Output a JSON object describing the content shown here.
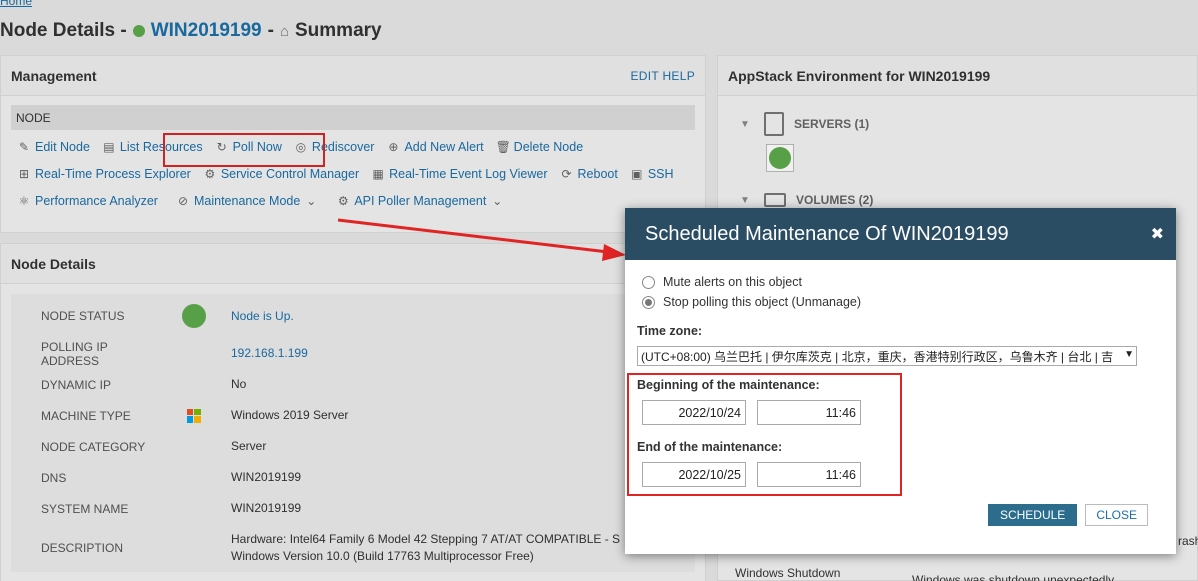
{
  "breadcrumb": "Home",
  "header": {
    "prefix": "Node Details -",
    "node_name": "WIN2019199",
    "separator": "-",
    "section": "Summary"
  },
  "management": {
    "title": "Management",
    "edit_help": "EDIT HELP",
    "node_bar": "NODE",
    "row1": [
      "Edit Node",
      "List Resources",
      "Poll Now",
      "Rediscover",
      "Add New Alert",
      "Delete Node"
    ],
    "row2": [
      "Real-Time Process Explorer",
      "Service Control Manager",
      "Real-Time Event Log Viewer",
      "Reboot",
      "SSH"
    ],
    "row3": [
      "Performance Analyzer",
      "Maintenance Mode",
      "API Poller Management"
    ]
  },
  "node_details": {
    "title": "Node Details",
    "rows": [
      {
        "key": "NODE STATUS",
        "value": "Node is Up."
      },
      {
        "key": "POLLING IP ADDRESS",
        "value": "192.168.1.199"
      },
      {
        "key": "DYNAMIC IP",
        "value": "No"
      },
      {
        "key": "MACHINE TYPE",
        "value": "Windows 2019 Server"
      },
      {
        "key": "NODE CATEGORY",
        "value": "Server"
      },
      {
        "key": "DNS",
        "value": "WIN2019199"
      },
      {
        "key": "SYSTEM NAME",
        "value": "WIN2019199"
      },
      {
        "key": "DESCRIPTION",
        "value": "Hardware: Intel64 Family 6 Model 42 Stepping 7 AT/AT COMPATIBLE - S",
        "value2": "Windows Version 10.0 (Build 17763 Multiprocessor Free)"
      }
    ]
  },
  "appstack": {
    "title": "AppStack Environment for WIN2019199",
    "servers_label": "SERVERS (1)",
    "volumes_label": "VOLUMES (2)",
    "event_label": "Windows Shutdown",
    "event_text": "Windows was shutdown unexpectedly",
    "crash_text": "rash"
  },
  "modal": {
    "title": "Scheduled Maintenance Of WIN2019199",
    "close_x": "✖",
    "radio_mute": "Mute alerts on this object",
    "radio_stop": "Stop polling this object (Unmanage)",
    "timezone_label": "Time zone:",
    "timezone_value": "(UTC+08:00) 乌兰巴托 | 伊尔库茨克 | 北京，重庆，香港特别行政区，乌鲁木齐 | 台北 | 吉",
    "begin_label": "Beginning of the maintenance:",
    "begin_date": "2022/10/24",
    "begin_time": "11:46",
    "end_label": "End of the maintenance:",
    "end_date": "2022/10/25",
    "end_time": "11:46",
    "schedule_button": "SCHEDULE",
    "close_button": "CLOSE"
  },
  "colors": {
    "accent_link": "#1b6fa8",
    "modal_header": "#2a4d63",
    "status_up": "#5daa4d",
    "highlight": "#e02424"
  }
}
